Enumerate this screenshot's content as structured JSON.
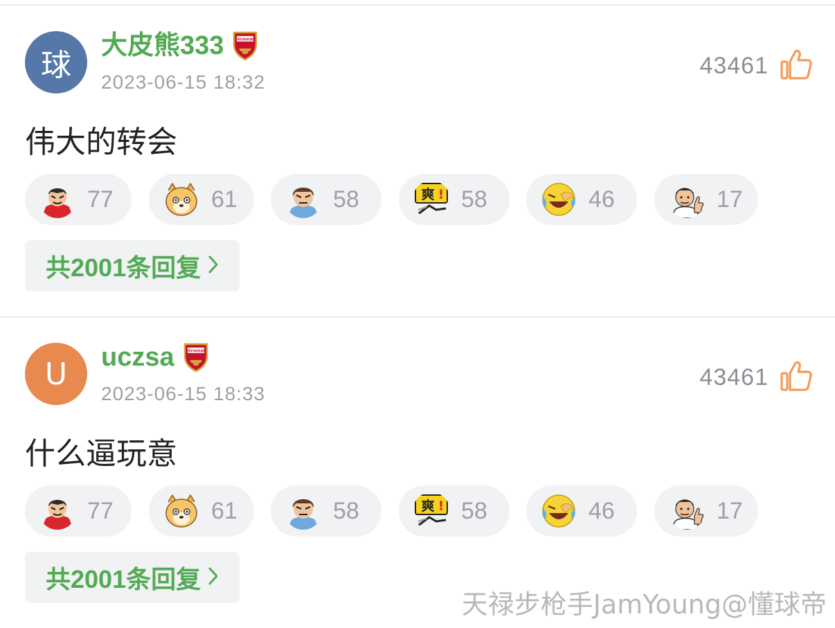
{
  "comments": [
    {
      "avatar_char": "球",
      "avatar_color": "#5578a8",
      "username": "大皮熊333",
      "badge_text": "Arsenal",
      "timestamp": "2023-06-15 18:32",
      "likes": "43461",
      "text": "伟大的转会",
      "reactions": [
        {
          "icon": "red-devil-emoji",
          "count": "77"
        },
        {
          "icon": "shiba-dog-emoji",
          "count": "61"
        },
        {
          "icon": "angry-man-emoji",
          "count": "58"
        },
        {
          "icon": "shuang-sign-emoji",
          "count": "58"
        },
        {
          "icon": "laughing-crying-emoji",
          "count": "46"
        },
        {
          "icon": "thumbs-up-man-emoji",
          "count": "17"
        }
      ],
      "replies_label": "共2001条回复"
    },
    {
      "avatar_char": "U",
      "avatar_color": "#e8894f",
      "username": "uczsa",
      "badge_text": "Arsenal",
      "timestamp": "2023-06-15 18:33",
      "likes": "43461",
      "text": "什么逼玩意",
      "reactions": [
        {
          "icon": "red-devil-emoji",
          "count": "77"
        },
        {
          "icon": "shiba-dog-emoji",
          "count": "61"
        },
        {
          "icon": "angry-man-emoji",
          "count": "58"
        },
        {
          "icon": "shuang-sign-emoji",
          "count": "58"
        },
        {
          "icon": "laughing-crying-emoji",
          "count": "46"
        },
        {
          "icon": "thumbs-up-man-emoji",
          "count": "17"
        }
      ],
      "replies_label": "共2001条回复"
    }
  ],
  "watermark": "天禄步枪手JamYoung@懂球帝",
  "colors": {
    "accent_green": "#52aa54",
    "like_orange": "#f39a55",
    "muted": "#9ea0a5"
  }
}
